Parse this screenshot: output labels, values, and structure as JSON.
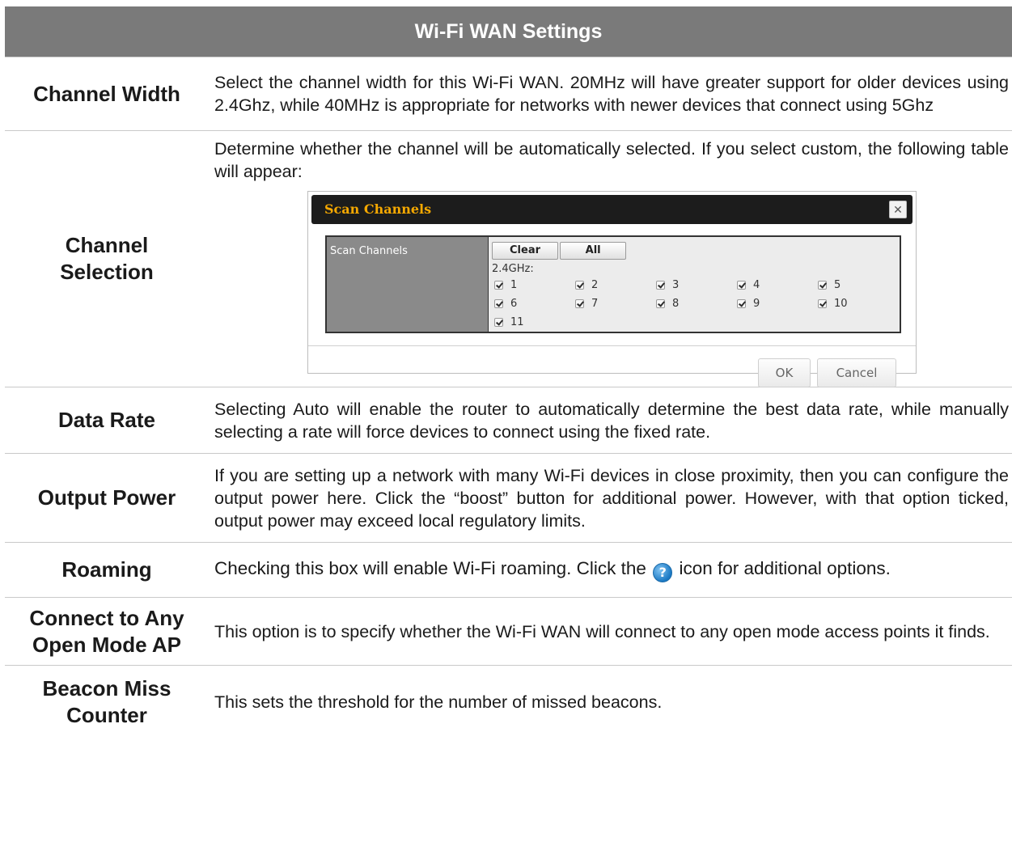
{
  "header": {
    "title": "Wi-Fi WAN Settings"
  },
  "rows": [
    {
      "label": "Channel Width",
      "description": "Select the channel width for this Wi-Fi WAN. 20MHz will have greater support for older devices using 2.4Ghz, while 40MHz is appropriate for networks with newer devices that connect using 5Ghz"
    },
    {
      "label": "Channel Selection",
      "description": "Determine whether the channel will be automatically selected. If you select custom, the following table will appear:"
    },
    {
      "label": "Data Rate",
      "description": "Selecting Auto will enable the router to automatically determine the best data rate, while manually selecting a rate will force devices to connect using the fixed rate."
    },
    {
      "label": "Output Power",
      "description": "If you are setting up a network with many Wi-Fi devices in close proximity, then you can configure the output power here. Click the “boost” button for additional power. However, with that option ticked, output power may exceed local regulatory limits."
    },
    {
      "label": "Roaming",
      "description_before": "Checking this box will enable Wi-Fi roaming. Click the",
      "description_after": "icon for additional options.",
      "icon": "help-icon"
    },
    {
      "label": "Connect to Any Open Mode AP",
      "description": "This option is to specify whether the Wi-Fi WAN will connect to any open mode access points it finds."
    },
    {
      "label": "Beacon Miss Counter",
      "description": "This sets the threshold for the number of missed beacons."
    }
  ],
  "dialog": {
    "title": "Scan Channels",
    "close_icon": "close-icon",
    "field_label": "Scan Channels",
    "clear_label": "Clear",
    "all_label": "All",
    "band_label": "2.4GHz:",
    "channels": [
      {
        "label": "1",
        "checked": true
      },
      {
        "label": "2",
        "checked": true
      },
      {
        "label": "3",
        "checked": true
      },
      {
        "label": "4",
        "checked": true
      },
      {
        "label": "5",
        "checked": true
      },
      {
        "label": "6",
        "checked": true
      },
      {
        "label": "7",
        "checked": true
      },
      {
        "label": "8",
        "checked": true
      },
      {
        "label": "9",
        "checked": true
      },
      {
        "label": "10",
        "checked": true
      },
      {
        "label": "11",
        "checked": true
      }
    ],
    "ok_label": "OK",
    "cancel_label": "Cancel"
  }
}
